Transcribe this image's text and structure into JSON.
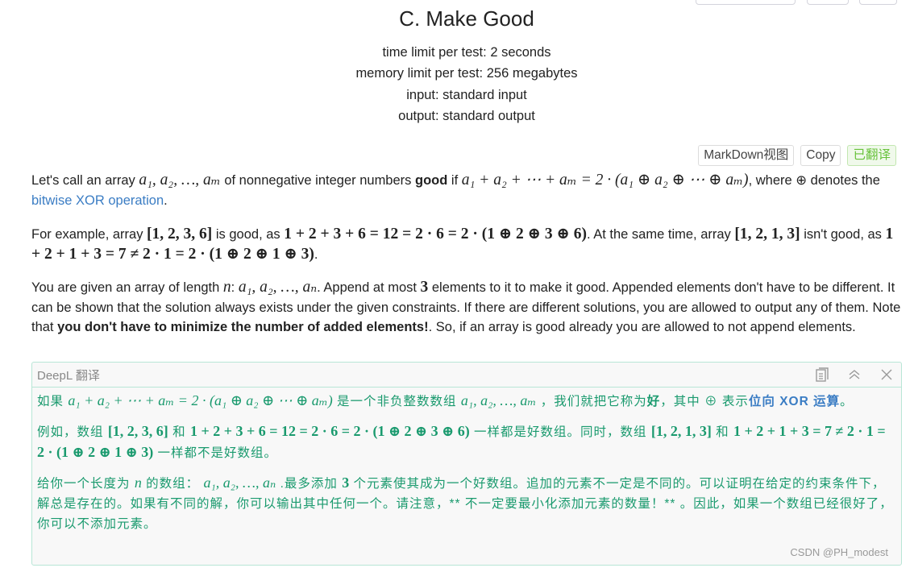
{
  "problem": {
    "title": "C. Make Good",
    "limits": {
      "time": "time limit per test: 2 seconds",
      "memory": "memory limit per test: 256 megabytes",
      "input": "input: standard input",
      "output": "output: standard output"
    },
    "buttons": {
      "markdown": "MarkDown视图",
      "copy": "Copy",
      "translated": "已翻译"
    },
    "p1": {
      "t1": "Let's call an array ",
      "m1": "a₁, a₂, …, aₘ",
      "t2": " of nonnegative integer numbers ",
      "bold": "good",
      "t3": " if ",
      "m2": "a₁ + a₂ + ⋯ + aₘ = 2 · (a₁ ⊕ a₂ ⊕ ⋯ ⊕ aₘ)",
      "t4": ", where ⊕ denotes the ",
      "link": "bitwise XOR operation",
      "t5": "."
    },
    "p2": {
      "t1": "For example, array ",
      "m1": "[1, 2, 3, 6]",
      "t2": " is good, as ",
      "m2": "1 + 2 + 3 + 6 = 12 = 2 · 6 = 2 · (1 ⊕ 2 ⊕ 3 ⊕ 6)",
      "t3": ". At the same time, array ",
      "m3": "[1, 2, 1, 3]",
      "t4": " isn't good, as ",
      "m4": "1 + 2 + 1 + 3 = 7 ≠ 2 · 1 = 2 · (1 ⊕ 2 ⊕ 1 ⊕ 3)",
      "t5": "."
    },
    "p3": {
      "t1": "You are given an array of length ",
      "m1": "n",
      "t2": ": ",
      "m2": "a₁, a₂, …, aₙ",
      "t3": ". Append at most ",
      "m3": "3",
      "t4": " elements to it to make it good. Appended elements don't have to be different. It can be shown that the solution always exists under the given constraints. If there are different solutions, you are allowed to output any of them. Note that ",
      "bold": "you don't have to minimize the number of added elements!",
      "t5": ". So, if an array is good already you are allowed to not append elements."
    }
  },
  "deepl": {
    "header": "DeepL 翻译",
    "p1": {
      "t1": "如果 ",
      "m1": "a₁ + a₂ + ⋯ + aₘ = 2 · (a₁ ⊕ a₂ ⊕ ⋯ ⊕ aₘ)",
      "t2": " 是一个非负整数数组 ",
      "m2": "a₁, a₂, …, aₘ",
      "t3": " ，我们就把它称为",
      "bold": "好",
      "t4": "，其中 ⊕ 表示",
      "link": "位向 XOR 运算",
      "t5": "。"
    },
    "p2": {
      "t1": "例如，数组 ",
      "m1": "[1, 2, 3, 6]",
      "t2": " 和 ",
      "m2": "1 + 2 + 3 + 6 = 12 = 2 · 6 = 2 · (1 ⊕ 2 ⊕ 3 ⊕ 6)",
      "t3": " 一样都是好数组。同时，数组 ",
      "m3": "[1, 2, 1, 3]",
      "t4": " 和 ",
      "m4": "1 + 2 + 1 + 3 = 7 ≠ 2 · 1 = 2 · (1 ⊕ 2 ⊕ 1 ⊕ 3)",
      "t5": " 一样都不是好数组。"
    },
    "p3": {
      "t1": "给你一个长度为 ",
      "m1": "n",
      "t2": " 的数组： ",
      "m2": "a₁, a₂, …, aₙ",
      "t3": " .最多添加 ",
      "m3": "3",
      "t4": " 个元素使其成为一个好数组。追加的元素不一定是不同的。可以证明在给定的约束条件下，解总是存在的。如果有不同的解，你可以输出其中任何一个。请注意，** 不一定要最小化添加元素的数量！** 。因此，如果一个数组已经很好了，你可以不添加元素。"
    },
    "watermark": "CSDN @PH_modest"
  },
  "colors": {
    "link": "#3b7dc4",
    "translation_text": "#1a9a6e",
    "translated_badge": "#67c23a",
    "panel_border": "#b8e6d6"
  }
}
